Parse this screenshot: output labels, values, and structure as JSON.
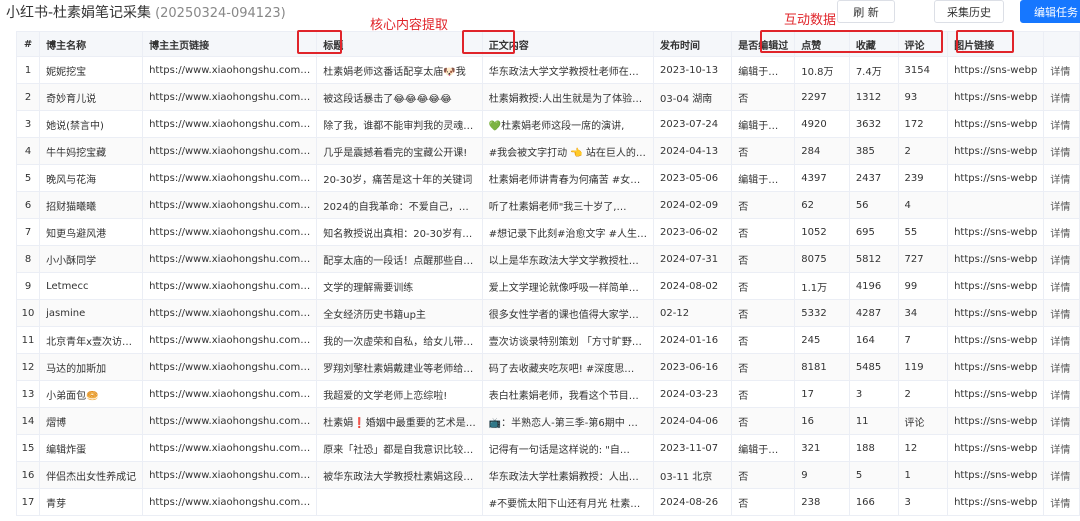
{
  "header": {
    "title": "小红书-杜素娟笔记采集",
    "subtitle": "(20250324-094123)",
    "refresh_label": "刷 新",
    "history_label": "采集历史",
    "edit_label": "编辑任务"
  },
  "annotations": {
    "core": "核心内容提取",
    "interaction": "互动数据"
  },
  "columns": [
    "#",
    "博主名称",
    "博主主页链接",
    "标题",
    "正文内容",
    "发布时间",
    "是否编辑过",
    "点赞",
    "收藏",
    "评论",
    "图片链接",
    "详情"
  ],
  "rows": [
    [
      "1",
      "妮妮挖宝",
      "https://www.xiaohongshu.com…",
      "杜素娟老师这番话配享太庙🐶我",
      "华东政法大学文学教授杜老师在…",
      "2023-10-13",
      "编辑于…",
      "10.8万",
      "7.4万",
      "3154",
      "https://sns-webp",
      "详情"
    ],
    [
      "2",
      "奇妙育儿说",
      "https://www.xiaohongshu.com…",
      "被这段话暴击了😂😂😂😂😂",
      "杜素娟教授:人出生就是为了体验…",
      "03-04 湖南",
      "否",
      "2297",
      "1312",
      "93",
      "https://sns-webp",
      "详情"
    ],
    [
      "3",
      "她说(禁言中)",
      "https://www.xiaohongshu.com…",
      "除了我，谁都不能审判我的灵魂…",
      "💚杜素娟老师这段一席的演讲,",
      "2023-07-24",
      "编辑于…",
      "4920",
      "3632",
      "172",
      "https://sns-webp",
      "详情"
    ],
    [
      "4",
      "牛牛妈挖宝藏",
      "https://www.xiaohongshu.com…",
      "几乎是震撼着看完的宝藏公开课!",
      "#我会被文字打动 👈 站在巨人的…",
      "2024-04-13",
      "否",
      "284",
      "385",
      "2",
      "https://sns-webp",
      "详情"
    ],
    [
      "5",
      "晚风与花海",
      "https://www.xiaohongshu.com…",
      "20-30岁，痛苦是这十年的关键词",
      "杜素娟老师讲青春为何痛苦 #女…",
      "2023-05-06",
      "编辑于…",
      "4397",
      "2437",
      "239",
      "https://sns-webp",
      "详情"
    ],
    [
      "6",
      "招财猫曦曦",
      "https://www.xiaohongshu.com…",
      "2024的自我革命：不爱自己，…",
      "听了杜素娟老师\"我三十岁了,…",
      "2024-02-09",
      "否",
      "62",
      "56",
      "4",
      "",
      "详情"
    ],
    [
      "7",
      "知更鸟避风港",
      "https://www.xiaohongshu.com…",
      "知名教授说出真相：20-30岁有…",
      "#想记录下此刻#治愈文字 #人生…",
      "2023-06-02",
      "否",
      "1052",
      "695",
      "55",
      "https://sns-webp",
      "详情"
    ],
    [
      "8",
      "小小酥同学",
      "https://www.xiaohongshu.com…",
      "配享太庙的一段话！点醒那些自…",
      "以上是华东政法大学文学教授杜…",
      "2024-07-31",
      "否",
      "8075",
      "5812",
      "727",
      "https://sns-webp",
      "详情"
    ],
    [
      "9",
      "Letmecc",
      "https://www.xiaohongshu.com…",
      "文学的理解需要训练",
      "爱上文学理论就像呼吸一样简单…",
      "2024-08-02",
      "否",
      "1.1万",
      "4196",
      "99",
      "https://sns-webp",
      "详情"
    ],
    [
      "10",
      "jasmine",
      "https://www.xiaohongshu.com…",
      "全女经济历史书籍up主",
      "很多女性学者的课也值得大家学…",
      "02-12",
      "否",
      "5332",
      "4287",
      "34",
      "https://sns-webp",
      "详情"
    ],
    [
      "11",
      "北京青年x壹次访…",
      "https://www.xiaohongshu.com…",
      "我的一次虚荣和自私，给女儿带…",
      "壹次访谈录特别策划 「方寸旷野…",
      "2024-01-16",
      "否",
      "245",
      "164",
      "7",
      "https://sns-webp",
      "详情"
    ],
    [
      "12",
      "马达的加斯加",
      "https://www.xiaohongshu.com…",
      "罗翔刘擎杜素娟戴建业等老师给…",
      "码了去收藏夹吃灰吧! #深度思…",
      "2023-06-16",
      "否",
      "8181",
      "5485",
      "119",
      "https://sns-webp",
      "详情"
    ],
    [
      "13",
      "小弟面包🥯",
      "https://www.xiaohongshu.com…",
      "我超爱的文学老师上恋综啦!",
      "表白杜素娟老师，我看这个节目…",
      "2024-03-23",
      "否",
      "17",
      "3",
      "2",
      "https://sns-webp",
      "详情"
    ],
    [
      "14",
      "熠博",
      "https://www.xiaohongshu.com…",
      "杜素娟❗婚姻中最重要的艺术是…",
      "📺：半熟恋人-第三季-第6期中 …",
      "2024-04-06",
      "否",
      "16",
      "11",
      "评论",
      "https://sns-webp",
      "详情"
    ],
    [
      "15",
      "编辑炸蛋",
      "https://www.xiaohongshu.com…",
      "原来「社恐」都是自我意识比较…",
      "记得有一句话是这样说的: \"自…",
      "2023-11-07",
      "编辑于…",
      "321",
      "188",
      "12",
      "https://sns-webp",
      "详情"
    ],
    [
      "16",
      "伴侣杰出女性养成记",
      "https://www.xiaohongshu.com…",
      "被华东政法大学教授杜素娟这段…",
      "华东政法大学杜素娟教授：人出…",
      "03-11 北京",
      "否",
      "9",
      "5",
      "1",
      "https://sns-webp",
      "详情"
    ],
    [
      "17",
      "青芽",
      "https://www.xiaohongshu.com…",
      "",
      "#不要慌太阳下山还有月光 杜素…",
      "2024-08-26",
      "否",
      "238",
      "166",
      "3",
      "https://sns-webp",
      "详情"
    ]
  ]
}
